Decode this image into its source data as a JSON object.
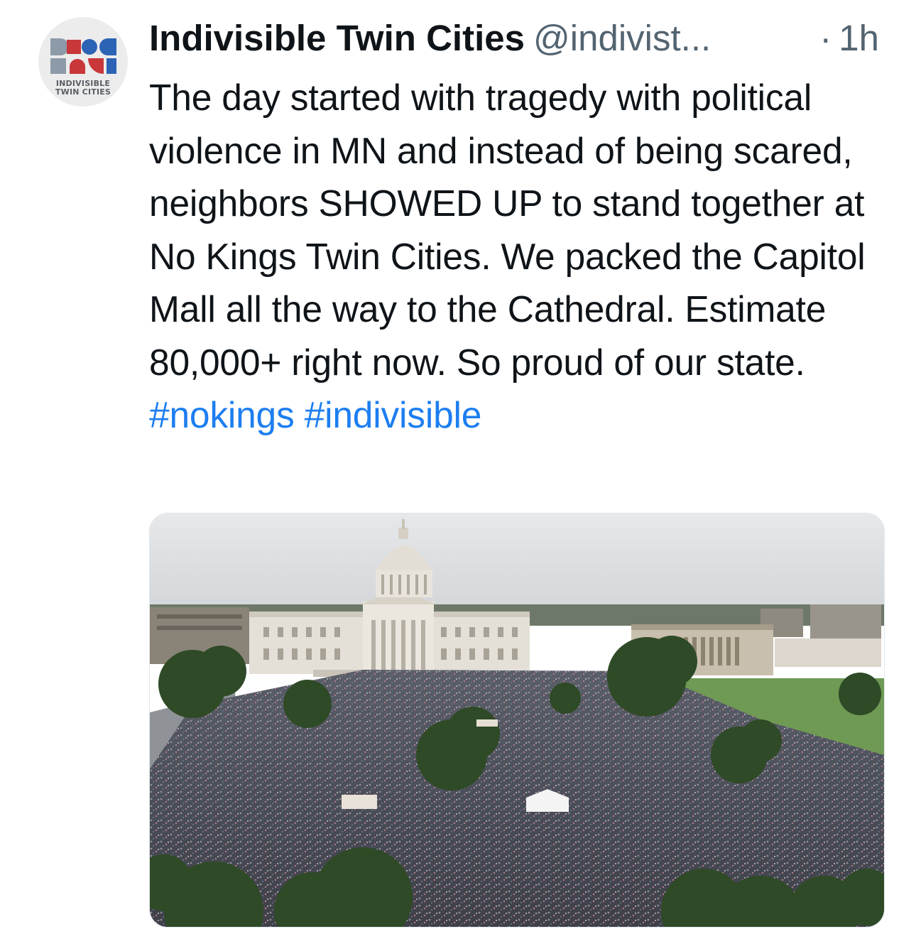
{
  "tweet": {
    "author": {
      "display_name": "Indivisible Twin Cities",
      "handle": "@indivist...",
      "avatar_text_line1": "INDIVISIBLE",
      "avatar_text_line2": "TWIN CITIES"
    },
    "time_separator": "·",
    "timestamp": "1h",
    "text_parts": {
      "body": "The day started with tragedy with political violence in MN and instead of being scared, neighbors SHOWED UP to stand together at No Kings Twin Cities. We packed the Capitol Mall all the way to the Cathedral. Estimate 80,000+ right now. So proud of our state.",
      "hashtag_1": "#nokings",
      "hashtag_2": "#indivisible"
    },
    "media": {
      "type": "photo",
      "description_icon": "photo-icon"
    }
  },
  "colors": {
    "hashtag": "#1d7ef0",
    "secondary_text": "#536471",
    "primary_text": "#0f1419"
  }
}
